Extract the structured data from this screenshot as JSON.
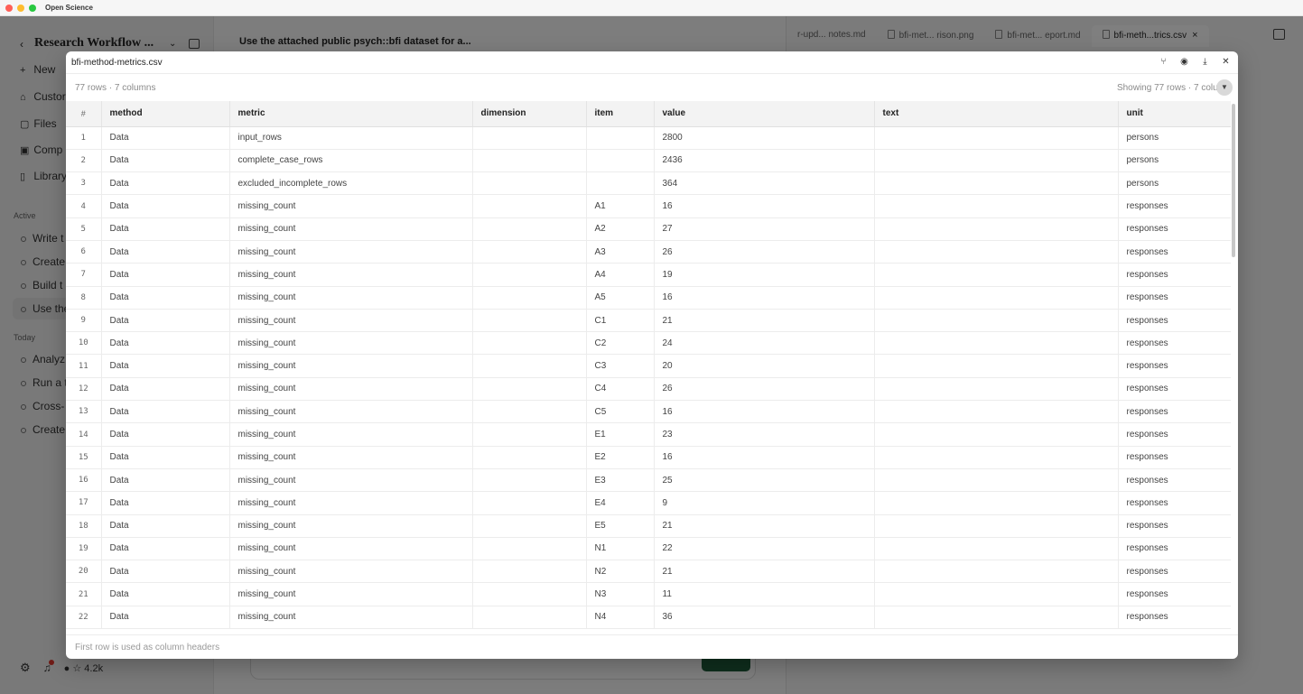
{
  "window": {
    "app_title": "Open Science"
  },
  "sidebar": {
    "workspace_title": "Research Workflow ...",
    "nav": [
      {
        "label": "New",
        "icon": "plus-icon"
      },
      {
        "label": "Custor",
        "icon": "lock-icon"
      },
      {
        "label": "Files",
        "icon": "file-icon"
      },
      {
        "label": "Comp",
        "icon": "compute-icon"
      },
      {
        "label": "Library",
        "icon": "book-icon"
      }
    ],
    "active_label": "Active",
    "active_threads": [
      "Write t",
      "Create",
      "Build t",
      "Use the"
    ],
    "today_label": "Today",
    "today_threads": [
      "Analyz",
      "Run a t",
      "Cross-",
      "Create"
    ],
    "stars": "4.2k"
  },
  "center": {
    "prompt_heading": "Use the attached public psych::bfi dataset for a..."
  },
  "right_pane": {
    "tabs": [
      {
        "label": "r-upd... notes.md",
        "active": false
      },
      {
        "label": "bfi-met... rison.png",
        "active": false
      },
      {
        "label": "bfi-met... eport.md",
        "active": false
      },
      {
        "label": "bfi-meth...trics.csv",
        "active": true
      }
    ]
  },
  "modal": {
    "title": "bfi-method-metrics.csv",
    "row_col_count": "77 rows · 7 columns",
    "showing_text": "Showing 77 rows · 7 colum",
    "footnote": "First row is used as column headers",
    "columns": [
      "#",
      "method",
      "metric",
      "dimension",
      "item",
      "value",
      "text",
      "unit"
    ],
    "rows": [
      [
        "1",
        "Data",
        "input_rows",
        "",
        "",
        "2800",
        "",
        "persons"
      ],
      [
        "2",
        "Data",
        "complete_case_rows",
        "",
        "",
        "2436",
        "",
        "persons"
      ],
      [
        "3",
        "Data",
        "excluded_incomplete_rows",
        "",
        "",
        "364",
        "",
        "persons"
      ],
      [
        "4",
        "Data",
        "missing_count",
        "",
        "A1",
        "16",
        "",
        "responses"
      ],
      [
        "5",
        "Data",
        "missing_count",
        "",
        "A2",
        "27",
        "",
        "responses"
      ],
      [
        "6",
        "Data",
        "missing_count",
        "",
        "A3",
        "26",
        "",
        "responses"
      ],
      [
        "7",
        "Data",
        "missing_count",
        "",
        "A4",
        "19",
        "",
        "responses"
      ],
      [
        "8",
        "Data",
        "missing_count",
        "",
        "A5",
        "16",
        "",
        "responses"
      ],
      [
        "9",
        "Data",
        "missing_count",
        "",
        "C1",
        "21",
        "",
        "responses"
      ],
      [
        "10",
        "Data",
        "missing_count",
        "",
        "C2",
        "24",
        "",
        "responses"
      ],
      [
        "11",
        "Data",
        "missing_count",
        "",
        "C3",
        "20",
        "",
        "responses"
      ],
      [
        "12",
        "Data",
        "missing_count",
        "",
        "C4",
        "26",
        "",
        "responses"
      ],
      [
        "13",
        "Data",
        "missing_count",
        "",
        "C5",
        "16",
        "",
        "responses"
      ],
      [
        "14",
        "Data",
        "missing_count",
        "",
        "E1",
        "23",
        "",
        "responses"
      ],
      [
        "15",
        "Data",
        "missing_count",
        "",
        "E2",
        "16",
        "",
        "responses"
      ],
      [
        "16",
        "Data",
        "missing_count",
        "",
        "E3",
        "25",
        "",
        "responses"
      ],
      [
        "17",
        "Data",
        "missing_count",
        "",
        "E4",
        "9",
        "",
        "responses"
      ],
      [
        "18",
        "Data",
        "missing_count",
        "",
        "E5",
        "21",
        "",
        "responses"
      ],
      [
        "19",
        "Data",
        "missing_count",
        "",
        "N1",
        "22",
        "",
        "responses"
      ],
      [
        "20",
        "Data",
        "missing_count",
        "",
        "N2",
        "21",
        "",
        "responses"
      ],
      [
        "21",
        "Data",
        "missing_count",
        "",
        "N3",
        "11",
        "",
        "responses"
      ],
      [
        "22",
        "Data",
        "missing_count",
        "",
        "N4",
        "36",
        "",
        "responses"
      ]
    ]
  }
}
